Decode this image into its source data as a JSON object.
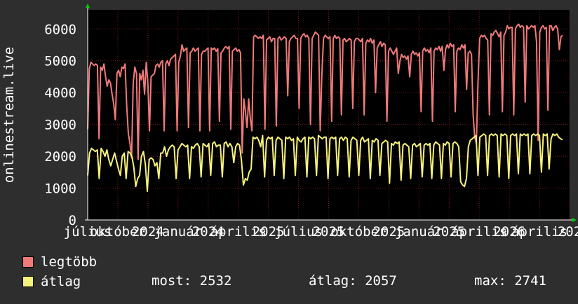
{
  "chart_data": {
    "type": "line",
    "ylabel": "onlinestream.live",
    "ylim": [
      0,
      6600
    ],
    "yticks": [
      0,
      1000,
      2000,
      3000,
      4000,
      5000,
      6000
    ],
    "x_tick_labels": [
      "július",
      "október",
      "2024",
      "január",
      "2024",
      "április",
      "2025",
      "július",
      "2025",
      "október",
      "2025",
      "január",
      "2025",
      "április",
      "2026",
      "április",
      "202"
    ],
    "grid": true,
    "colors": {
      "background": "#000000",
      "grid": "#6b1a1a",
      "axis": "#ffffff",
      "max_series": "#f07a7a",
      "avg_series": "#f7f27c",
      "arrow": "#00cc00"
    },
    "series": [
      {
        "name": "legtöbb",
        "color": "#f07a7a",
        "values": [
          2850,
          4750,
          4950,
          4900,
          4850,
          4900,
          4850,
          2550,
          4800,
          4700,
          4900,
          4500,
          4200,
          4400,
          4300,
          3950,
          3650,
          3150,
          4600,
          4700,
          4500,
          4800,
          4750,
          4900,
          3600,
          2700,
          2400,
          1950,
          4300,
          4800,
          4600,
          1900,
          4600,
          4400,
          4700,
          3950,
          4950,
          4300,
          2800,
          4500,
          4550,
          4600,
          4850,
          4900,
          4800,
          4950,
          5000,
          2800,
          4900,
          5000,
          4850,
          5050,
          5100,
          5150,
          5200,
          2800,
          4950,
          5150,
          5500,
          5300,
          5350,
          5400,
          2900,
          5250,
          5300,
          5400,
          5300,
          5350,
          5400,
          2800,
          5200,
          5300,
          5300,
          5350,
          5400,
          2800,
          5400,
          5350,
          5400,
          5300,
          5380,
          3100,
          5250,
          5300,
          5400,
          5450,
          5380,
          5450,
          2850,
          5300,
          5350,
          5400,
          5300,
          5350,
          5250,
          2100,
          3800,
          3400,
          2900,
          3800,
          3200,
          2800,
          5750,
          5800,
          5750,
          5700,
          5750,
          5700,
          5800,
          2850,
          5650,
          5700,
          5750,
          5600,
          5700,
          5700,
          2950,
          5700,
          5750,
          5650,
          5700,
          5750,
          5700,
          3900,
          5600,
          5700,
          5750,
          5800,
          5700,
          5700,
          3500,
          5700,
          5800,
          5850,
          5750,
          5800,
          5700,
          3000,
          5700,
          5800,
          5900,
          5850,
          5800,
          2800,
          4600,
          5700,
          5800,
          5750,
          5700,
          5750,
          3100,
          5700,
          5800,
          5700,
          5750,
          5700,
          3300,
          5650,
          5700,
          5600,
          5650,
          5700,
          5650,
          3500,
          5600,
          5700,
          5700,
          5650,
          5600,
          5700,
          3300,
          5550,
          5650,
          5600,
          5700,
          5550,
          5650,
          4000,
          5400,
          5500,
          5600,
          5450,
          5550,
          5500,
          3100,
          5300,
          5400,
          5300,
          5200,
          5300,
          5400,
          4600,
          5000,
          5200,
          5100,
          5150,
          5050,
          5150,
          4500,
          5200,
          5300,
          5200,
          5250,
          5150,
          5250,
          3400,
          5300,
          5400,
          5300,
          5350,
          5250,
          5400,
          3100,
          5300,
          5400,
          5350,
          5450,
          5300,
          5450,
          4700,
          5350,
          5500,
          5400,
          5550,
          5450,
          5500,
          3400,
          5300,
          5400,
          5350,
          5500,
          5400,
          5500,
          4100,
          5250,
          5300,
          5200,
          3300,
          2600,
          2400,
          4300,
          5700,
          5800,
          5750,
          5800,
          5700,
          5650,
          3300,
          5850,
          5800,
          5900,
          5950,
          5850,
          5750,
          5900,
          3400,
          5800,
          5900,
          6100,
          6000,
          6050,
          6050,
          3300,
          6000,
          6100,
          6150,
          6050,
          6100,
          6050,
          3700,
          6100,
          6000,
          6050,
          6100,
          6050,
          6100,
          5600,
          2500,
          5900,
          6050,
          6100,
          6000,
          6050,
          3450,
          6100,
          6100,
          5950,
          6050,
          6100,
          6000,
          5350,
          5750,
          5800
        ]
      },
      {
        "name": "átlag",
        "color": "#f7f27c",
        "values": [
          1400,
          2100,
          2250,
          2200,
          2150,
          2200,
          1300,
          2250,
          2150,
          2000,
          2200,
          1900,
          1700,
          1900,
          2100,
          1850,
          1600,
          1400,
          2000,
          2100,
          1300,
          2150,
          2100,
          2000,
          1650,
          1050,
          1300,
          1400,
          2000,
          2150,
          1750,
          900,
          1900,
          1950,
          1900,
          1700,
          1800,
          1300,
          2100,
          2100,
          2300,
          2000,
          2200,
          2300,
          2350,
          2300,
          1300,
          2200,
          2300,
          2400,
          2350,
          2300,
          2350,
          1300,
          2300,
          2250,
          2350,
          2400,
          2300,
          1350,
          2400,
          2350,
          2300,
          2400,
          1400,
          2400,
          2450,
          2300,
          2350,
          2350,
          1350,
          2400,
          2450,
          2300,
          2400,
          2300,
          1800,
          2300,
          2400,
          2350,
          1850,
          1100,
          1300,
          1250,
          1500,
          1600,
          2600,
          2550,
          2600,
          2500,
          2300,
          2650,
          1350,
          2500,
          2600,
          2550,
          2600,
          1400,
          2500,
          2600,
          2550,
          2500,
          1300,
          2600,
          2550,
          2600,
          2500,
          2550,
          1400,
          2600,
          2500,
          2450,
          2550,
          2600,
          1350,
          2600,
          2550,
          2600,
          2550,
          1400,
          2650,
          2600,
          2550,
          2600,
          2600,
          1300,
          2550,
          2600,
          2550,
          2600,
          1400,
          2550,
          2600,
          2500,
          2600,
          2550,
          1350,
          2500,
          2600,
          2550,
          2500,
          1400,
          2500,
          2600,
          2450,
          2500,
          2550,
          1300,
          2500,
          2450,
          2550,
          2500,
          1400,
          2400,
          2450,
          2500,
          2450,
          1150,
          2400,
          2350,
          2450,
          2400,
          2450,
          1250,
          2350,
          2400,
          2350,
          2300,
          1300,
          2350,
          2400,
          2300,
          2350,
          2400,
          1350,
          2350,
          2400,
          2350,
          2400,
          1300,
          2350,
          2450,
          2400,
          2350,
          1300,
          2400,
          2350,
          2450,
          2400,
          1350,
          2400,
          2450,
          2400,
          2300,
          1200,
          1100,
          1050,
          1300,
          2300,
          2500,
          2550,
          2600,
          2650,
          1400,
          2600,
          2650,
          2700,
          2650,
          1400,
          2650,
          2700,
          2650,
          2700,
          2650,
          1350,
          2700,
          2650,
          2700,
          2650,
          1300,
          2650,
          2700,
          2650,
          2700,
          1450,
          2700,
          2650,
          2700,
          2650,
          2700,
          1450,
          2650,
          2700,
          2650,
          2700,
          2650,
          1500,
          2700,
          2650,
          2700,
          1600,
          2550,
          2700,
          2650,
          2700,
          2600,
          2550,
          2520
        ]
      }
    ],
    "legend": [
      {
        "label": "legtöbb",
        "color": "#f07a7a"
      },
      {
        "label": "átlag",
        "color": "#f7f27c"
      }
    ],
    "stats": {
      "most_label": "most:",
      "most_value": "2532",
      "avg_label": "átlag:",
      "avg_value": "2057",
      "max_label": "max:",
      "max_value": "2741"
    }
  }
}
